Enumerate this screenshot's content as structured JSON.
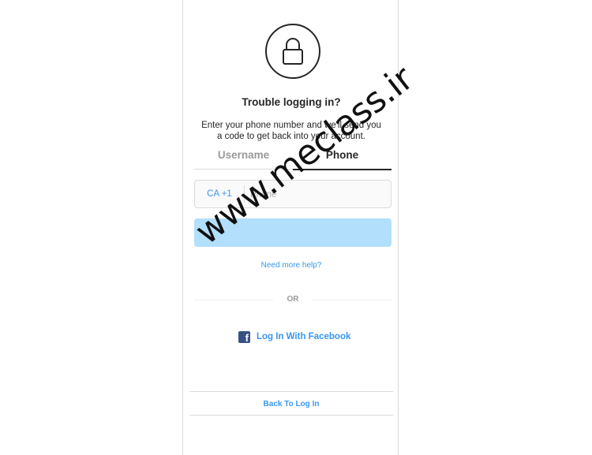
{
  "screen": {
    "title": "Trouble logging in?",
    "description": "Enter your phone number and we'll send you a code to get back into your account."
  },
  "tabs": [
    {
      "label": "Username",
      "active": false
    },
    {
      "label": "Phone",
      "active": true
    }
  ],
  "phone_field": {
    "country_code": "CA +1",
    "placeholder": "Phone",
    "value": ""
  },
  "next_button": {
    "label": "",
    "color": "#b2dffc"
  },
  "help_link": "Need more help?",
  "divider": "OR",
  "facebook_login": "Log In With Facebook",
  "back_to_login": "Back To Log In",
  "watermark": "www.meclass.ir",
  "colors": {
    "accent": "#3897f0",
    "facebook": "#385185"
  }
}
